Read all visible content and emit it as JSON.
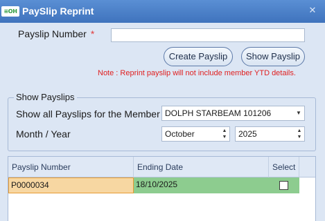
{
  "window": {
    "logo_text": "≡OH",
    "title": "PaySlip Reprint",
    "close_glyph": "✕"
  },
  "form": {
    "payslip_number_label": "Payslip Number",
    "required_marker": "*",
    "payslip_number_value": "",
    "create_button": "Create Payslip",
    "show_button": "Show Payslip",
    "note": "Note :  Reprint payslip will not include member YTD details."
  },
  "show_payslips": {
    "group_title": "Show Payslips",
    "member_label": "Show all Payslips for the Member",
    "member_value": "DOLPH STARBEAM 101206",
    "period_label": "Month / Year",
    "month_value": "October",
    "year_value": "2025"
  },
  "grid": {
    "columns": [
      "Payslip Number",
      "Ending Date",
      "Select"
    ],
    "rows": [
      {
        "payslip_number": "P0000034",
        "ending_date": "18/10/2025",
        "selected": false
      }
    ]
  },
  "colors": {
    "title_bar": "#4a80c8",
    "window_bg": "#dce6f4",
    "note_text": "#e02020",
    "row_highlight": "#8dcc8f",
    "active_cell": "#f7d7a2"
  }
}
